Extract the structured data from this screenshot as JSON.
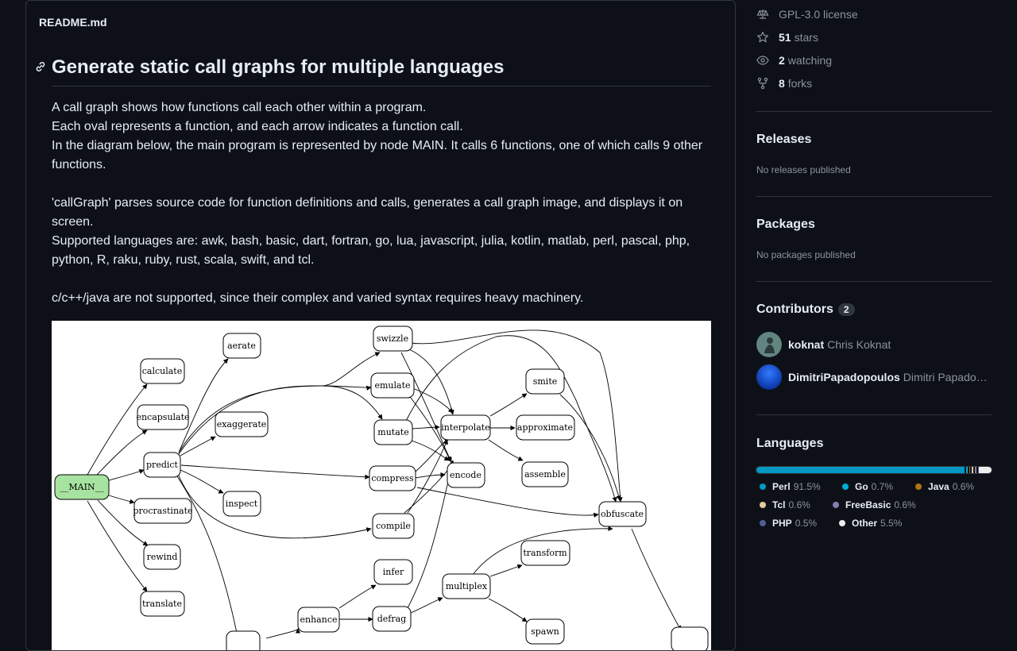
{
  "readme": {
    "filename": "README.md",
    "heading": "Generate static call graphs for multiple languages",
    "paragraphs": [
      "A call graph shows how functions call each other within a program.",
      "Each oval represents a function, and each arrow indicates a function call.",
      "In the diagram below, the main program is represented by node MAIN. It calls 6 functions, one of which calls 9 other functions.",
      "'callGraph' parses source code for function definitions and calls, generates a call graph image, and displays it on screen.",
      "Supported languages are: awk, bash, basic, dart, fortran, go, lua, javascript, julia, kotlin, matlab, perl, pascal, php, python, R, raku, ruby, rust, scala, swift, and tcl.",
      "c/c++/java are not supported, since their complex and varied syntax requires heavy machinery."
    ],
    "graph": {
      "nodes": {
        "main": "__MAIN__",
        "calculate": "calculate",
        "encapsulate": "encapsulate",
        "predict": "predict",
        "procrastinate": "procrastinate",
        "rewind": "rewind",
        "translate": "translate",
        "aerate": "aerate",
        "exaggerate": "exaggerate",
        "inspect": "inspect",
        "swizzle": "swizzle",
        "emulate": "emulate",
        "mutate": "mutate",
        "compress": "compress",
        "compile": "compile",
        "infer": "infer",
        "defrag": "defrag",
        "enhance": "enhance",
        "interpolate": "interpolate",
        "encode": "encode",
        "multiplex": "multiplex",
        "smite": "smite",
        "approximate": "approximate",
        "assemble": "assemble",
        "transform": "transform",
        "spawn": "spawn",
        "obfuscate": "obfuscate"
      }
    }
  },
  "sidebar": {
    "license": "GPL-3.0 license",
    "stars": {
      "count": "51",
      "label": "stars"
    },
    "watching": {
      "count": "2",
      "label": "watching"
    },
    "forks": {
      "count": "8",
      "label": "forks"
    },
    "releases": {
      "title": "Releases",
      "note": "No releases published"
    },
    "packages": {
      "title": "Packages",
      "note": "No packages published"
    },
    "contributors": {
      "title": "Contributors",
      "count": "2",
      "people": [
        {
          "login": "koknat",
          "name": "Chris Koknat"
        },
        {
          "login": "DimitriPapadopoulos",
          "name": "Dimitri Papadopoulos"
        }
      ]
    },
    "languages": {
      "title": "Languages",
      "items": [
        {
          "name": "Perl",
          "pct": "91.5%",
          "value": 91.5,
          "color": "#0298c3"
        },
        {
          "name": "Go",
          "pct": "0.7%",
          "value": 0.7,
          "color": "#00add8"
        },
        {
          "name": "Java",
          "pct": "0.6%",
          "value": 0.6,
          "color": "#b07219"
        },
        {
          "name": "Tcl",
          "pct": "0.6%",
          "value": 0.6,
          "color": "#e4cc98"
        },
        {
          "name": "FreeBasic",
          "pct": "0.6%",
          "value": 0.6,
          "color": "#867db1"
        },
        {
          "name": "PHP",
          "pct": "0.5%",
          "value": 0.5,
          "color": "#4f5d95"
        },
        {
          "name": "Other",
          "pct": "5.5%",
          "value": 5.5,
          "color": "#ededed"
        }
      ]
    }
  }
}
